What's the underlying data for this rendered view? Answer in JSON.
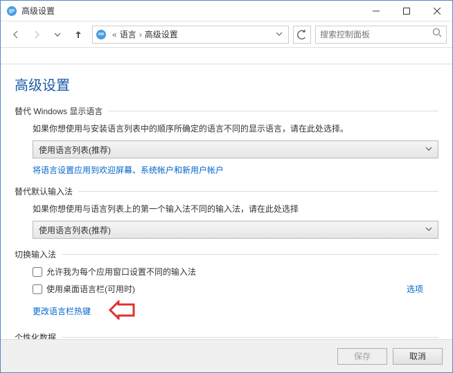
{
  "window": {
    "title": "高级设置"
  },
  "nav": {
    "breadcrumb_sep": "«",
    "crumb1": "语言",
    "crumb2": "高级设置",
    "search_placeholder": "搜索控制面板"
  },
  "page": {
    "heading": "高级设置"
  },
  "section1": {
    "title": "替代 Windows 显示语言",
    "desc": "如果你想使用与安装语言列表中的顺序所确定的语言不同的显示语言，请在此处选择。",
    "combo": "使用语言列表(推荐)",
    "link": "将语言设置应用到欢迎屏幕、系统帐户和新用户帐户"
  },
  "section2": {
    "title": "替代默认输入法",
    "desc": "如果你想使用与语言列表上的第一个输入法不同的输入法，请在此处选择",
    "combo": "使用语言列表(推荐)"
  },
  "section3": {
    "title": "切换输入法",
    "cb1": "允许我为每个应用窗口设置不同的输入法",
    "cb2": "使用桌面语言栏(可用时)",
    "options": "选项",
    "hotkey_link": "更改语言栏热键"
  },
  "section4": {
    "title": "个性化数据"
  },
  "footer": {
    "save": "保存",
    "cancel": "取消"
  }
}
